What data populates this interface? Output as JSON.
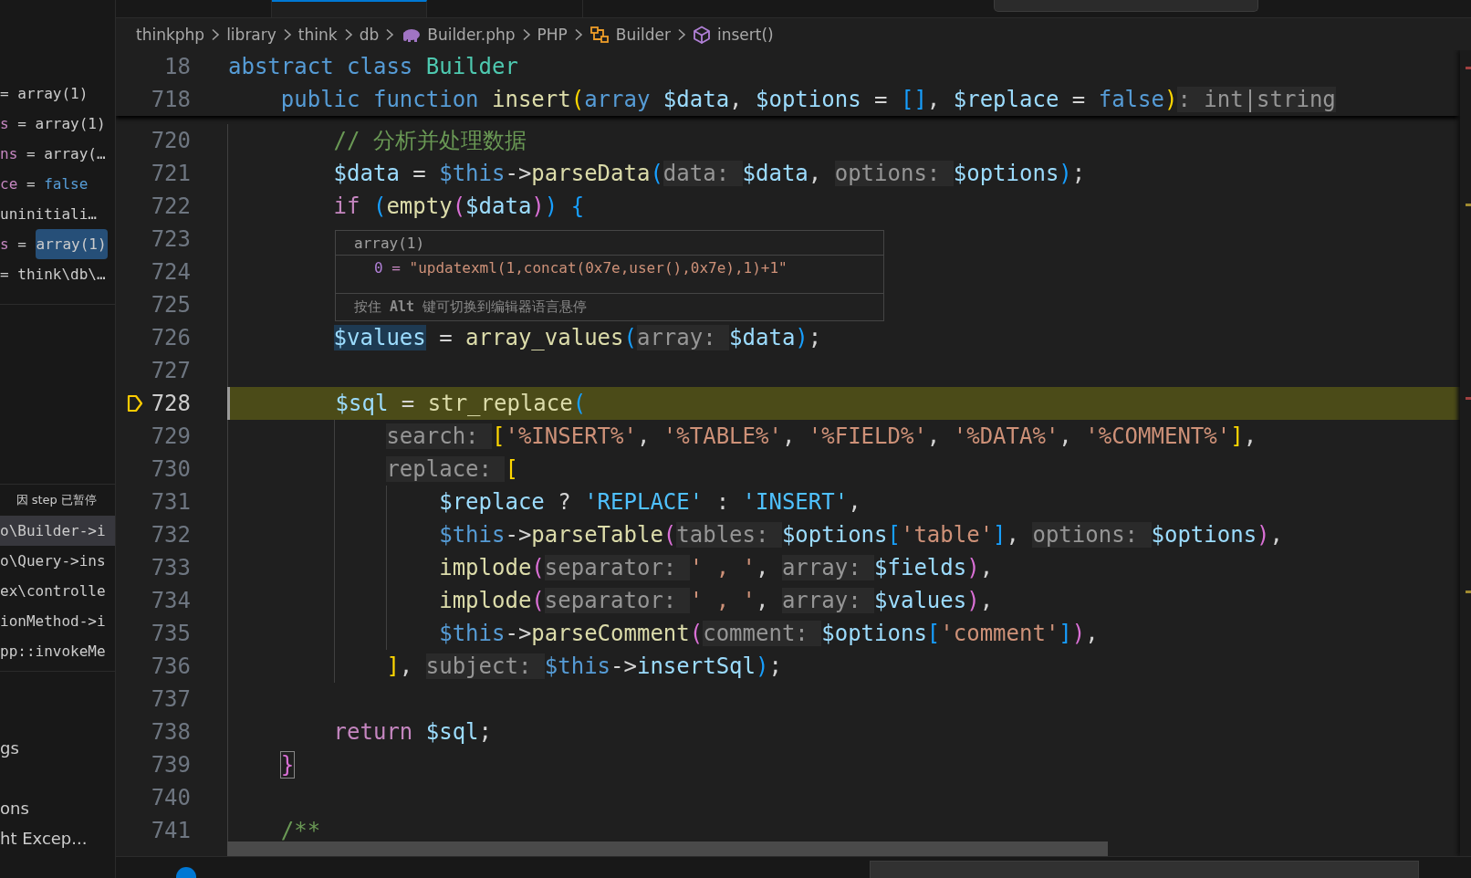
{
  "tabs": [
    {
      "selected": false
    },
    {
      "selected": true
    },
    {
      "selected": false
    }
  ],
  "sidebar": {
    "variables": [
      {
        "equals": "=",
        "value": "array(1)",
        "kind": "plain",
        "highlighted": false
      },
      {
        "name": "s",
        "equals": "=",
        "value": "array(1)",
        "kind": "plain",
        "highlighted": false
      },
      {
        "name": "ns",
        "equals": "=",
        "value": "array(…",
        "kind": "plain",
        "highlighted": false
      },
      {
        "name": "ce",
        "equals": "=",
        "value": "false",
        "kind": "bool",
        "highlighted": false
      },
      {
        "value": "uninitiali…",
        "kind": "plain",
        "highlighted": false
      },
      {
        "name": "s",
        "equals": "=",
        "value": "array(1)",
        "kind": "plain",
        "highlighted": true
      },
      {
        "equals": "=",
        "value": "think\\db\\…",
        "kind": "plain",
        "highlighted": false
      }
    ],
    "call_stack": {
      "status": "因 step 已暂停",
      "frames": [
        {
          "label": "o\\Builder->i",
          "selected": true
        },
        {
          "label": "o\\Query->ins",
          "selected": false
        },
        {
          "label": "ex\\controlle",
          "selected": false
        },
        {
          "label": "ionMethod->i",
          "selected": false
        },
        {
          "label": "pp::invokeMe",
          "selected": false
        }
      ]
    },
    "breakpoints": [
      "gs",
      "ons",
      "ht Excep..."
    ]
  },
  "breadcrumb": [
    {
      "label": "thinkphp",
      "kind": "folder"
    },
    {
      "label": "library",
      "kind": "folder"
    },
    {
      "label": "think",
      "kind": "folder"
    },
    {
      "label": "db",
      "kind": "folder"
    },
    {
      "label": "Builder.php",
      "kind": "php"
    },
    {
      "label": "PHP",
      "kind": "language"
    },
    {
      "label": "Builder",
      "kind": "class"
    },
    {
      "label": "insert()",
      "kind": "method"
    }
  ],
  "sticky_lines": [
    {
      "number": "18",
      "current": false,
      "code": [
        {
          "text": "abstract class ",
          "kind": "kw"
        },
        {
          "text": "Builder",
          "kind": "cls"
        }
      ]
    },
    {
      "number": "718",
      "current": false,
      "code": [
        {
          "text": "    public function ",
          "kind": "kw"
        },
        {
          "text": "insert",
          "kind": "fn"
        },
        {
          "text": "(",
          "kind": "b1"
        },
        {
          "text": "array ",
          "kind": "kw"
        },
        {
          "text": "$data",
          "kind": "var"
        },
        {
          "text": ", ",
          "kind": "op"
        },
        {
          "text": "$options",
          "kind": "var"
        },
        {
          "text": " = ",
          "kind": "op"
        },
        {
          "text": "[]",
          "kind": "b3"
        },
        {
          "text": ", ",
          "kind": "op"
        },
        {
          "text": "$replace",
          "kind": "var"
        },
        {
          "text": " = ",
          "kind": "op"
        },
        {
          "text": "false",
          "kind": "kw"
        },
        {
          "text": ")",
          "kind": "b1"
        },
        {
          "text": ": int|string",
          "kind": "hint"
        }
      ]
    }
  ],
  "lines": [
    {
      "number": "720",
      "current": false,
      "code": [
        {
          "text": "        // 分析并处理数据",
          "kind": "cmt"
        }
      ]
    },
    {
      "number": "721",
      "current": false,
      "code": [
        {
          "text": "        $data",
          "kind": "var"
        },
        {
          "text": " = ",
          "kind": "op"
        },
        {
          "text": "$this",
          "kind": "kw"
        },
        {
          "text": "->",
          "kind": "op"
        },
        {
          "text": "parseData",
          "kind": "fn"
        },
        {
          "text": "(",
          "kind": "b3"
        },
        {
          "text": "data: ",
          "kind": "hint"
        },
        {
          "text": "$data",
          "kind": "var"
        },
        {
          "text": ", ",
          "kind": "op"
        },
        {
          "text": "options: ",
          "kind": "hint"
        },
        {
          "text": "$options",
          "kind": "var"
        },
        {
          "text": ")",
          "kind": "b3"
        },
        {
          "text": ";",
          "kind": "op"
        }
      ]
    },
    {
      "number": "722",
      "current": false,
      "code": [
        {
          "text": "        if ",
          "kind": "ctrl"
        },
        {
          "text": "(",
          "kind": "b3"
        },
        {
          "text": "empty",
          "kind": "fn"
        },
        {
          "text": "(",
          "kind": "b2"
        },
        {
          "text": "$data",
          "kind": "var"
        },
        {
          "text": ")",
          "kind": "b2"
        },
        {
          "text": ") ",
          "kind": "b3"
        },
        {
          "text": "{",
          "kind": "b3"
        }
      ]
    },
    {
      "number": "723",
      "current": false
    },
    {
      "number": "724",
      "current": false
    },
    {
      "number": "725",
      "current": false
    },
    {
      "number": "726",
      "current": false,
      "code": [
        {
          "text": "        $values",
          "kind": "varhl"
        },
        {
          "text": " = ",
          "kind": "op"
        },
        {
          "text": "array_values",
          "kind": "fn"
        },
        {
          "text": "(",
          "kind": "b3"
        },
        {
          "text": "array: ",
          "kind": "hint"
        },
        {
          "text": "$data",
          "kind": "var"
        },
        {
          "text": ")",
          "kind": "b3"
        },
        {
          "text": ";",
          "kind": "op"
        }
      ]
    },
    {
      "number": "727",
      "current": false
    },
    {
      "number": "728",
      "current": true,
      "code": [
        {
          "text": "        $sql",
          "kind": "var"
        },
        {
          "text": " = ",
          "kind": "op"
        },
        {
          "text": "str_replace",
          "kind": "fn"
        },
        {
          "text": "(",
          "kind": "b3"
        }
      ]
    },
    {
      "number": "729",
      "current": false,
      "code": [
        {
          "text": "            search: ",
          "kind": "hint"
        },
        {
          "text": "[",
          "kind": "b1"
        },
        {
          "text": "'%INSERT%'",
          "kind": "str"
        },
        {
          "text": ", ",
          "kind": "op"
        },
        {
          "text": "'%TABLE%'",
          "kind": "str"
        },
        {
          "text": ", ",
          "kind": "op"
        },
        {
          "text": "'%FIELD%'",
          "kind": "str"
        },
        {
          "text": ", ",
          "kind": "op"
        },
        {
          "text": "'%DATA%'",
          "kind": "str"
        },
        {
          "text": ", ",
          "kind": "op"
        },
        {
          "text": "'%COMMENT%'",
          "kind": "str"
        },
        {
          "text": "]",
          "kind": "b1"
        },
        {
          "text": ",",
          "kind": "op"
        }
      ]
    },
    {
      "number": "730",
      "current": false,
      "code": [
        {
          "text": "            replace: ",
          "kind": "hint"
        },
        {
          "text": "[",
          "kind": "b1"
        }
      ]
    },
    {
      "number": "731",
      "current": false,
      "code": [
        {
          "text": "                $replace",
          "kind": "var"
        },
        {
          "text": " ? ",
          "kind": "op"
        },
        {
          "text": "'REPLACE'",
          "kind": "const"
        },
        {
          "text": " : ",
          "kind": "op"
        },
        {
          "text": "'INSERT'",
          "kind": "const"
        },
        {
          "text": ",",
          "kind": "op"
        }
      ]
    },
    {
      "number": "732",
      "current": false,
      "code": [
        {
          "text": "                $this",
          "kind": "kw"
        },
        {
          "text": "->",
          "kind": "op"
        },
        {
          "text": "parseTable",
          "kind": "fn"
        },
        {
          "text": "(",
          "kind": "b2"
        },
        {
          "text": "tables: ",
          "kind": "hint"
        },
        {
          "text": "$options",
          "kind": "var"
        },
        {
          "text": "[",
          "kind": "b3"
        },
        {
          "text": "'table'",
          "kind": "str"
        },
        {
          "text": "]",
          "kind": "b3"
        },
        {
          "text": ", ",
          "kind": "op"
        },
        {
          "text": "options: ",
          "kind": "hint"
        },
        {
          "text": "$options",
          "kind": "var"
        },
        {
          "text": ")",
          "kind": "b2"
        },
        {
          "text": ",",
          "kind": "op"
        }
      ]
    },
    {
      "number": "733",
      "current": false,
      "code": [
        {
          "text": "                implode",
          "kind": "fn"
        },
        {
          "text": "(",
          "kind": "b2"
        },
        {
          "text": "separator: ",
          "kind": "hint"
        },
        {
          "text": "' , '",
          "kind": "str"
        },
        {
          "text": ", ",
          "kind": "op"
        },
        {
          "text": "array: ",
          "kind": "hint"
        },
        {
          "text": "$fields",
          "kind": "var"
        },
        {
          "text": ")",
          "kind": "b2"
        },
        {
          "text": ",",
          "kind": "op"
        }
      ]
    },
    {
      "number": "734",
      "current": false,
      "code": [
        {
          "text": "                implode",
          "kind": "fn"
        },
        {
          "text": "(",
          "kind": "b2"
        },
        {
          "text": "separator: ",
          "kind": "hint"
        },
        {
          "text": "' , '",
          "kind": "str"
        },
        {
          "text": ", ",
          "kind": "op"
        },
        {
          "text": "array: ",
          "kind": "hint"
        },
        {
          "text": "$values",
          "kind": "var"
        },
        {
          "text": ")",
          "kind": "b2"
        },
        {
          "text": ",",
          "kind": "op"
        }
      ]
    },
    {
      "number": "735",
      "current": false,
      "code": [
        {
          "text": "                $this",
          "kind": "kw"
        },
        {
          "text": "->",
          "kind": "op"
        },
        {
          "text": "parseComment",
          "kind": "fn"
        },
        {
          "text": "(",
          "kind": "b2"
        },
        {
          "text": "comment: ",
          "kind": "hint"
        },
        {
          "text": "$options",
          "kind": "var"
        },
        {
          "text": "[",
          "kind": "b3"
        },
        {
          "text": "'comment'",
          "kind": "str"
        },
        {
          "text": "]",
          "kind": "b3"
        },
        {
          "text": ")",
          "kind": "b2"
        },
        {
          "text": ",",
          "kind": "op"
        }
      ]
    },
    {
      "number": "736",
      "current": false,
      "code": [
        {
          "text": "            ]",
          "kind": "b1"
        },
        {
          "text": ", ",
          "kind": "op"
        },
        {
          "text": "subject: ",
          "kind": "hint"
        },
        {
          "text": "$this",
          "kind": "kw"
        },
        {
          "text": "->",
          "kind": "op"
        },
        {
          "text": "insertSql",
          "kind": "var"
        },
        {
          "text": ")",
          "kind": "b3"
        },
        {
          "text": ";",
          "kind": "op"
        }
      ]
    },
    {
      "number": "737",
      "current": false
    },
    {
      "number": "738",
      "current": false,
      "code": [
        {
          "text": "        return ",
          "kind": "ctrl"
        },
        {
          "text": "$sql",
          "kind": "var"
        },
        {
          "text": ";",
          "kind": "op"
        }
      ]
    },
    {
      "number": "739",
      "current": false,
      "code": [
        {
          "text": "    }",
          "kind": "b2box"
        }
      ]
    },
    {
      "number": "740",
      "current": false
    },
    {
      "number": "741",
      "current": false,
      "code": [
        {
          "text": "    /**",
          "kind": "cmt"
        }
      ]
    }
  ],
  "hover": {
    "header": "array(1)",
    "key": "0",
    "equals": "=",
    "value": "\"updatexml(1,concat(0x7e,user(),0x7e),1)+1\"",
    "footer": "按住 **Alt** 键可切换到编辑器语言悬停"
  }
}
